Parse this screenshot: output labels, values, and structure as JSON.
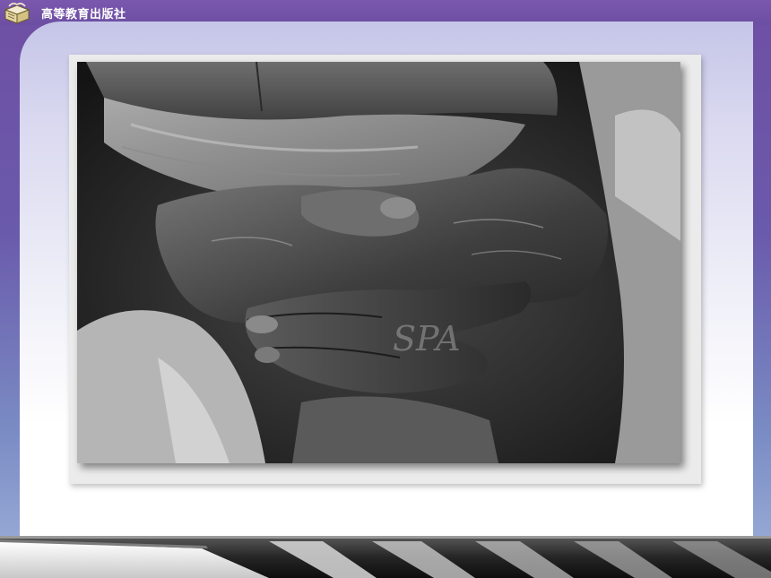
{
  "header": {
    "publisher_name": "高等教育出版社",
    "logo_icon": "book-box-icon"
  },
  "slide": {
    "photo_icon": "photograph-clasped-hands-image",
    "watermark": "SPA"
  },
  "colors": {
    "topbar": "#6c4ea2",
    "background_top": "#6f4fa3",
    "background_bottom": "#9fb2da",
    "panel_top": "#c5c6e8",
    "panel_bottom": "#ffffff",
    "footer_dark": "#1f1f1f",
    "footer_light": "#e6e6e6"
  }
}
